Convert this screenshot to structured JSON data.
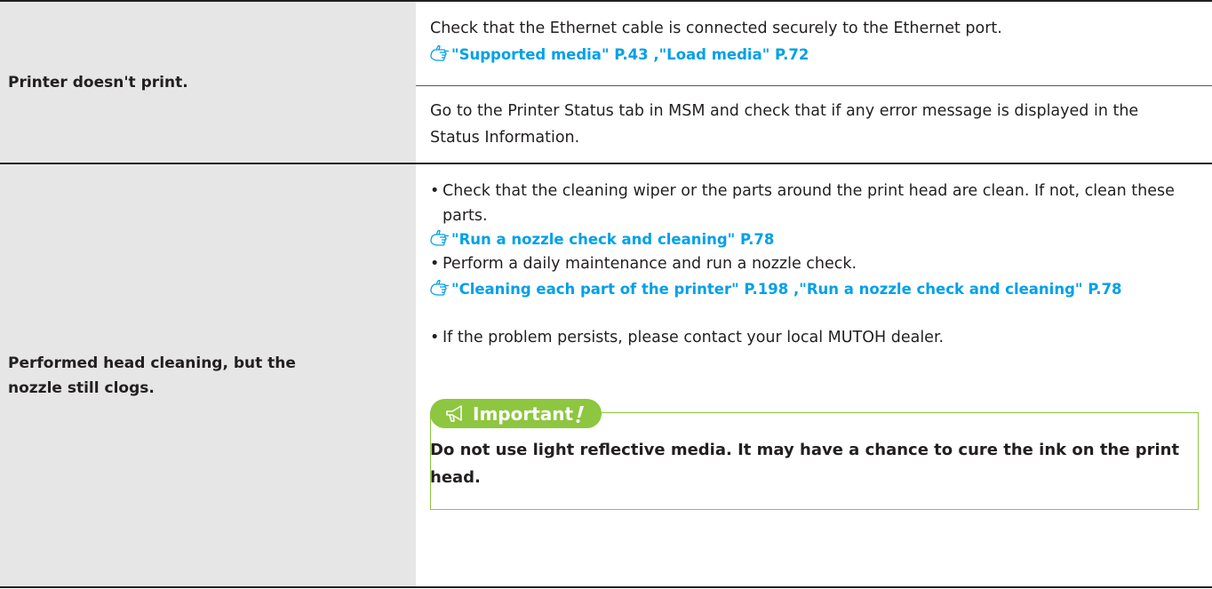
{
  "rows": [
    {
      "problem": "Printer doesn't print.",
      "solutions": [
        {
          "text": "Check that the Ethernet cable is connected securely to the Ethernet port.",
          "link": "\"Supported media\" P.43 ,\"Load media\" P.72"
        },
        {
          "text": "Go to the Printer Status tab in MSM and check that if any error message is displayed in the Status Information."
        }
      ]
    },
    {
      "problem": "Performed head cleaning, but the nozzle still clogs.",
      "bullets": [
        "Check that the cleaning wiper or the parts around the print head are clean. If not, clean these parts.",
        "Perform a daily maintenance and run a nozzle check.",
        "If the problem persists, please contact your local MUTOH dealer."
      ],
      "links": [
        "\"Run a nozzle check and cleaning\" P.78",
        "\"Cleaning each part of the printer\" P.198 ,\"Run a nozzle check and cleaning\" P.78"
      ],
      "important": {
        "label": "Important",
        "text": "Do not use light reflective media. It may have a chance to cure the ink on the print head."
      }
    }
  ],
  "colors": {
    "accent_green": "#8dc63f",
    "link_blue": "#00a0e9",
    "left_cell_bg": "#e6e6e6"
  },
  "icons": [
    "reference-hand-icon",
    "megaphone-icon",
    "exclamation-icon"
  ]
}
